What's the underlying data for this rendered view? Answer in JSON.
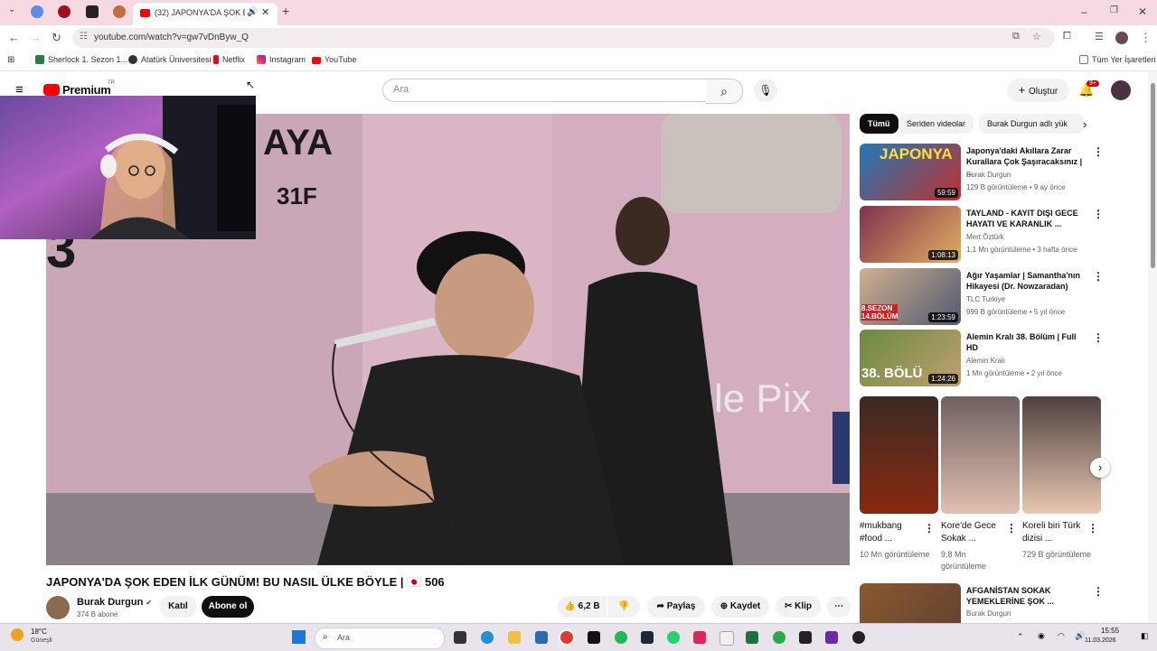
{
  "browser": {
    "tab_title": "(32) JAPONYA'DA ŞOK EDEN",
    "url": "youtube.com/watch?v=gw7vDnByw_Q",
    "bookmarks": [
      "Sherlock 1. Sezon 1...",
      "Atatürk Üniversitesi",
      "Netflix",
      "Instagram",
      "YouTube"
    ],
    "all_bookmarks": "Tüm Yer İşaretleri"
  },
  "yt": {
    "logo_text": "Premium",
    "logo_sup": "TR",
    "search_placeholder": "Ara",
    "create_label": "Oluştur",
    "notif_count": "9+"
  },
  "video": {
    "title": "JAPONYA'DA ŞOK EDEN İLK GÜNÜM! BU NASIL ÜLKE BÖYLE | 🇯🇵 506",
    "channel": "Burak Durgun",
    "subs": "374 B abone",
    "join": "Katıl",
    "subscribe": "Abone ol",
    "likes": "6,2 B",
    "share": "Paylaş",
    "save": "Kaydet",
    "clip": "Klip"
  },
  "chips": [
    "Tümü",
    "Seriden videolar",
    "Burak Durgun adlı yük"
  ],
  "recommendations": [
    {
      "title": "Japonya'daki Akıllara Zarar Kurallara Çok Şaşıracaksınız | ...",
      "channel": "Burak Durgun",
      "meta": "129 B görüntüleme • 9 ay önce",
      "duration": "59:59",
      "thumb_text": "JAPONYA"
    },
    {
      "title": "TAYLAND - KAYIT DIŞI GECE HAYATI VE KARANLIK ...",
      "channel": "Mert Öztürk",
      "meta": "1,1 Mn görüntüleme • 3 hafta önce",
      "duration": "1:08:13",
      "thumb_text": ""
    },
    {
      "title": "Ağır Yaşamlar | Samantha'nın Hikayesi (Dr. Nowzaradan)",
      "channel": "TLC Turkiye",
      "meta": "999 B görüntüleme • 5 yıl önce",
      "duration": "1:23:59",
      "thumb_text": "8.SEZON 14.BÖLÜM"
    },
    {
      "title": "Alemin Kralı 38. Bölüm | Full HD",
      "channel": "Alemin Kralı",
      "meta": "1 Mn görüntüleme • 2 yıl önce",
      "duration": "1:24:26",
      "thumb_text": "38. BÖLÜ"
    }
  ],
  "shorts": [
    {
      "title": "#mukbang #food ...",
      "views": "10 Mn görüntüleme"
    },
    {
      "title": "Kore'de Gece Sokak ...",
      "views": "9,8 Mn görüntüleme"
    },
    {
      "title": "Koreli biri Türk dizisi ...",
      "views": "729 B görüntüleme"
    }
  ],
  "next_rec": {
    "title": "AFGANİSTAN SOKAK YEMEKLERİNE ŞOK ...",
    "channel": "Burak Durgun"
  },
  "taskbar": {
    "weather_temp": "18°C",
    "weather_desc": "Güneşli",
    "search_placeholder": "Ara",
    "time": "15:55",
    "date": "11.03.2026"
  }
}
